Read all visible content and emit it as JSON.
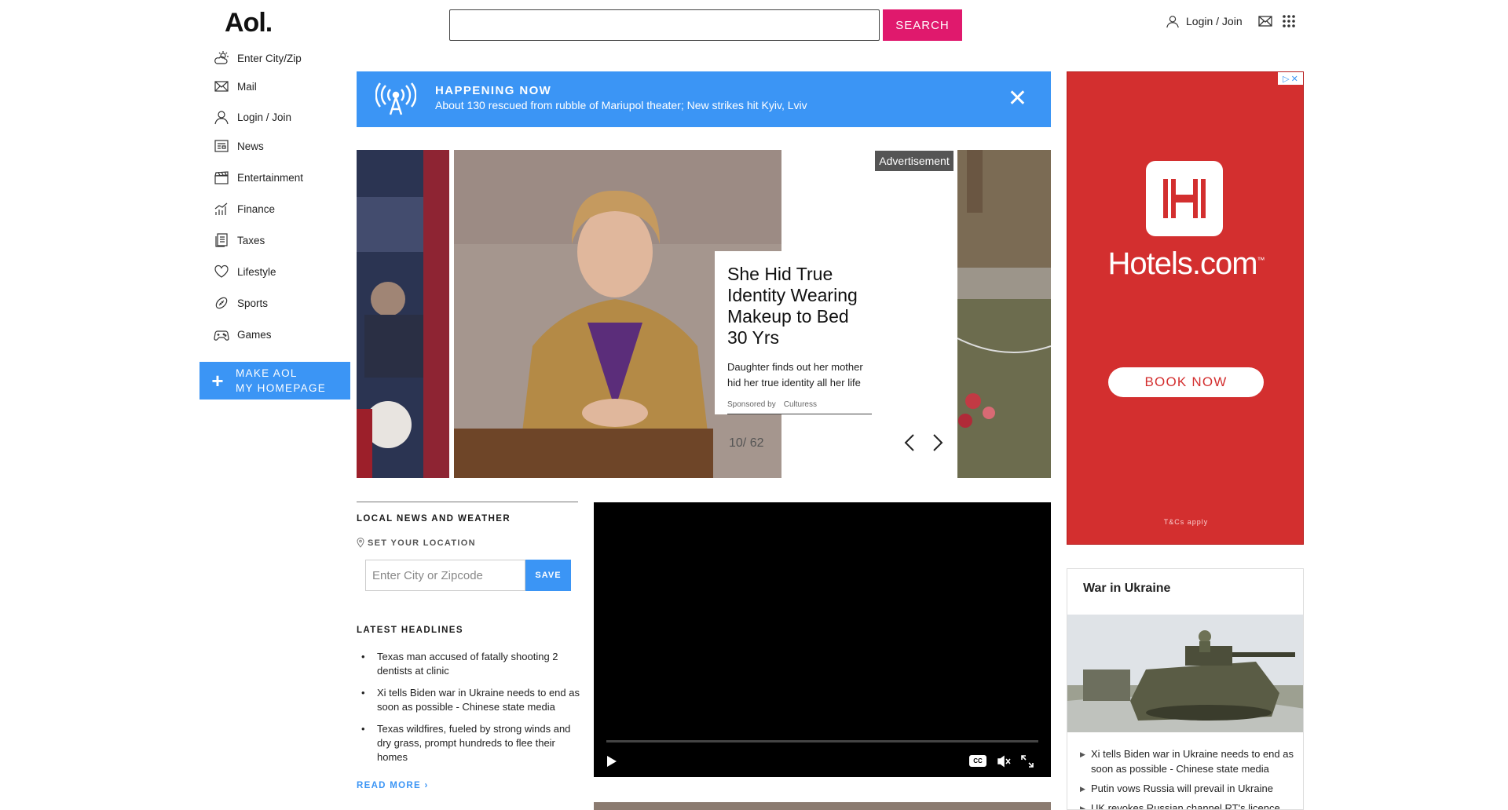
{
  "header": {
    "logo": "Aol.",
    "search_button": "SEARCH",
    "login": "Login / Join"
  },
  "sidebar": {
    "items": [
      {
        "label": "Enter City/Zip",
        "icon": "weather-icon"
      },
      {
        "label": "Mail",
        "icon": "mail-icon"
      },
      {
        "label": "Login / Join",
        "icon": "user-icon"
      },
      {
        "label": "News",
        "icon": "news-icon"
      },
      {
        "label": "Entertainment",
        "icon": "clapper-icon"
      },
      {
        "label": "Finance",
        "icon": "chart-icon"
      },
      {
        "label": "Taxes",
        "icon": "document-icon"
      },
      {
        "label": "Lifestyle",
        "icon": "heart-icon"
      },
      {
        "label": "Sports",
        "icon": "football-icon"
      },
      {
        "label": "Games",
        "icon": "gamepad-icon"
      }
    ],
    "homepage_line1": "MAKE AOL",
    "homepage_line2": "MY HOMEPAGE"
  },
  "happening": {
    "title": "HAPPENING NOW",
    "text": "About 130 rescued from rubble of Mariupol theater; New strikes hit Kyiv, Lviv"
  },
  "slideshow": {
    "ad_label": "Advertisement",
    "headline": "She Hid True Identity Wearing Makeup to Bed 30 Yrs",
    "description": "Daughter finds out her mother hid her true identity all her life",
    "sponsored_by": "Sponsored by",
    "sponsor": "Culturess",
    "counter": "10/ 62"
  },
  "local": {
    "title": "LOCAL NEWS AND WEATHER",
    "set_location": "SET YOUR LOCATION",
    "zip_placeholder": "Enter City or Zipcode",
    "save": "SAVE",
    "latest_title": "LATEST HEADLINES",
    "headlines": [
      "Texas man accused of fatally shooting 2 dentists at clinic",
      "Xi tells Biden war in Ukraine needs to end as soon as possible - Chinese state media",
      "Texas wildfires, fueled by strong winds and dry grass, prompt hundreds to flee their homes"
    ],
    "read_more": "READ MORE ›"
  },
  "video": {
    "cc": "CC"
  },
  "ad": {
    "brand": "Hotels.com",
    "tm": "™",
    "book": "BOOK NOW",
    "tc": "T&Cs apply"
  },
  "war": {
    "title": "War in Ukraine",
    "items": [
      "Xi tells Biden war in Ukraine needs to end as soon as possible - Chinese state media",
      "Putin vows Russia will prevail in Ukraine",
      "UK revokes Russian channel RT's licence"
    ]
  },
  "colors": {
    "accent_blue": "#3b95f5",
    "search_pink": "#e0196d",
    "ad_red": "#d32f2f"
  }
}
